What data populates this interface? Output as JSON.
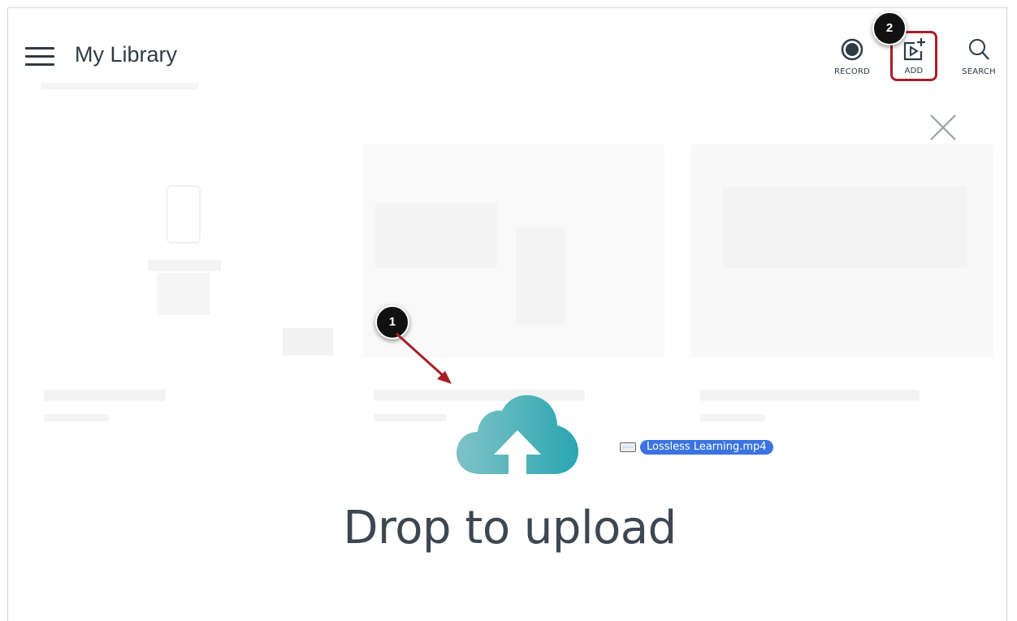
{
  "header": {
    "title": "My Library",
    "menu_icon": "hamburger-menu-icon",
    "tools": {
      "record_label": "RECORD",
      "add_label": "ADD",
      "search_label": "SEARCH"
    }
  },
  "callouts": {
    "step1": "1",
    "step2": "2",
    "highlight_color": "#a81e28",
    "arrow_color": "#a81e28"
  },
  "drop_zone": {
    "message": "Drop to upload",
    "icon": "cloud-upload-icon",
    "cloud_colors": [
      "#7fc3c6",
      "#2aa6b2"
    ],
    "dragged_file": "Lossless Learning.mp4"
  },
  "colors": {
    "text": "#2d3b45",
    "file_chip": "#3b74e0"
  }
}
